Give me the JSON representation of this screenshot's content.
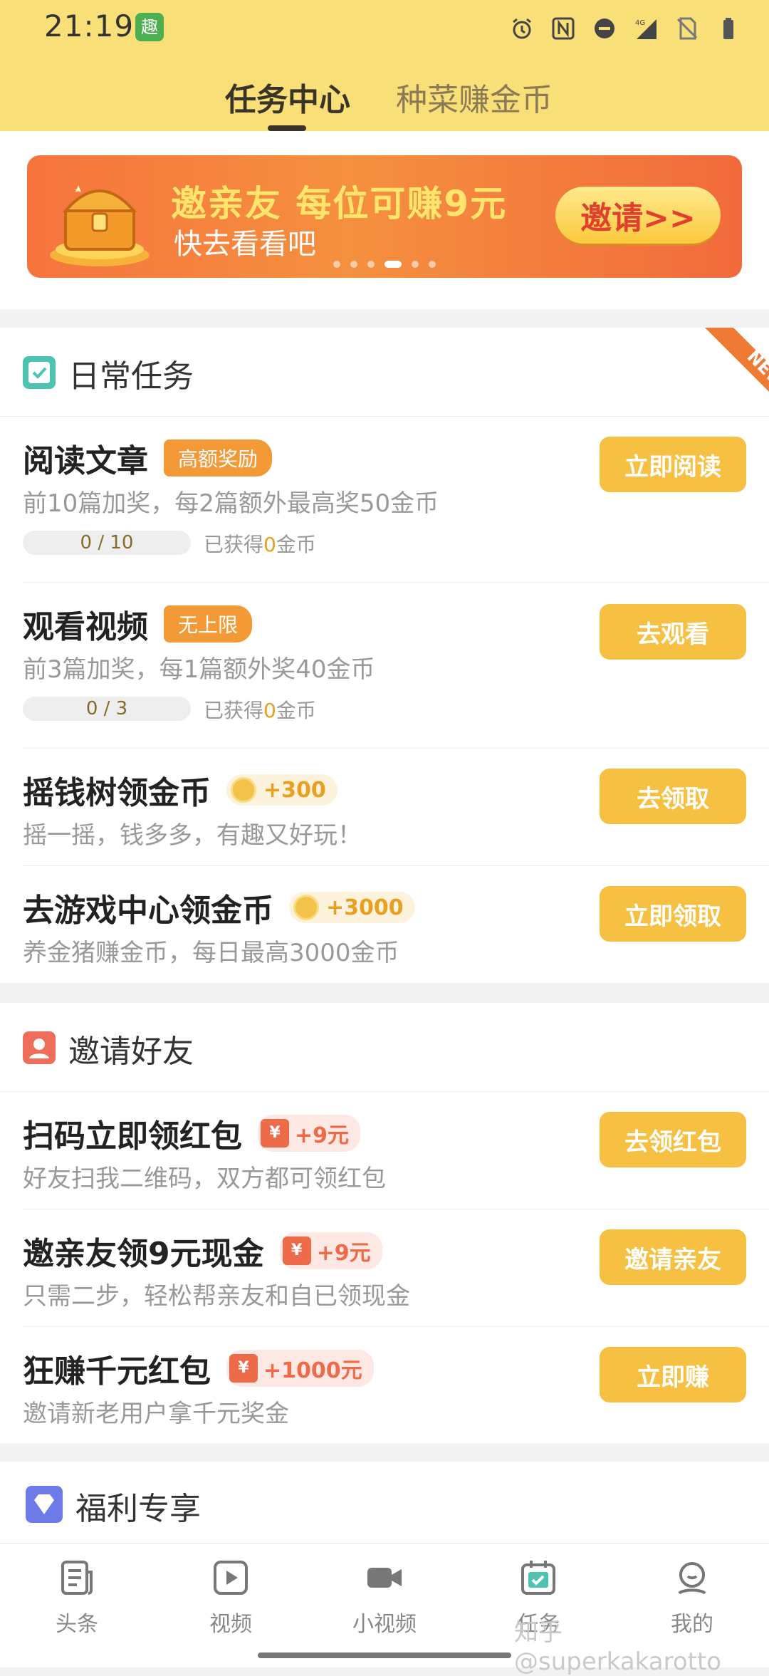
{
  "status": {
    "time": "21:19",
    "app_icon_text": "趣",
    "network": "4G"
  },
  "tabs": [
    {
      "label": "任务中心"
    },
    {
      "label": "种菜赚金币"
    }
  ],
  "banner": {
    "title": "邀亲友 每位可赚9元",
    "subtitle": "快去看看吧",
    "button": "邀请>>"
  },
  "daily": {
    "title": "日常任务",
    "ribbon": "NEW",
    "tasks": [
      {
        "title": "阅读文章",
        "badge": "高额奖励",
        "desc": "前10篇加奖，每2篇额外最高奖50金币",
        "progress": "0 / 10",
        "earned_pre": "已获得",
        "earned_num": "0",
        "earned_post": "金币",
        "button": "立即阅读"
      },
      {
        "title": "观看视频",
        "badge": "无上限",
        "desc": "前3篇加奖，每1篇额外奖40金币",
        "progress": "0 / 3",
        "earned_pre": "已获得",
        "earned_num": "0",
        "earned_post": "金币",
        "button": "去观看"
      },
      {
        "title": "摇钱树领金币",
        "reward": "+300",
        "desc": "摇一摇，钱多多，有趣又好玩！",
        "button": "去领取"
      },
      {
        "title": "去游戏中心领金币",
        "reward": "+3000",
        "desc": "养金猪赚金币，每日最高3000金币",
        "button": "立即领取"
      }
    ]
  },
  "invite": {
    "title": "邀请好友",
    "tasks": [
      {
        "title": "扫码立即领红包",
        "reward": "+9元",
        "env": "¥",
        "desc": "好友扫我二维码，双方都可领红包",
        "button": "去领红包"
      },
      {
        "title": "邀亲友领9元现金",
        "reward": "+9元",
        "env": "¥",
        "desc": "只需二步，轻松帮亲友和自已领现金",
        "button": "邀请亲友"
      },
      {
        "title": "狂赚千元红包",
        "reward": "+1000元",
        "env": "¥",
        "desc": "邀请新老用户拿千元奖金",
        "button": "立即赚"
      }
    ]
  },
  "welfare": {
    "title": "福利专享"
  },
  "bottom_nav": [
    {
      "label": "头条",
      "icon": "news-icon"
    },
    {
      "label": "视频",
      "icon": "video-icon"
    },
    {
      "label": "小视频",
      "icon": "camera-icon"
    },
    {
      "label": "任务",
      "icon": "task-icon"
    },
    {
      "label": "我的",
      "icon": "profile-icon"
    }
  ],
  "watermark": "知乎 @superkakarotto",
  "colors": {
    "header": "#f9df78",
    "button": "#f6c043",
    "accent_orange": "#f39a37"
  }
}
